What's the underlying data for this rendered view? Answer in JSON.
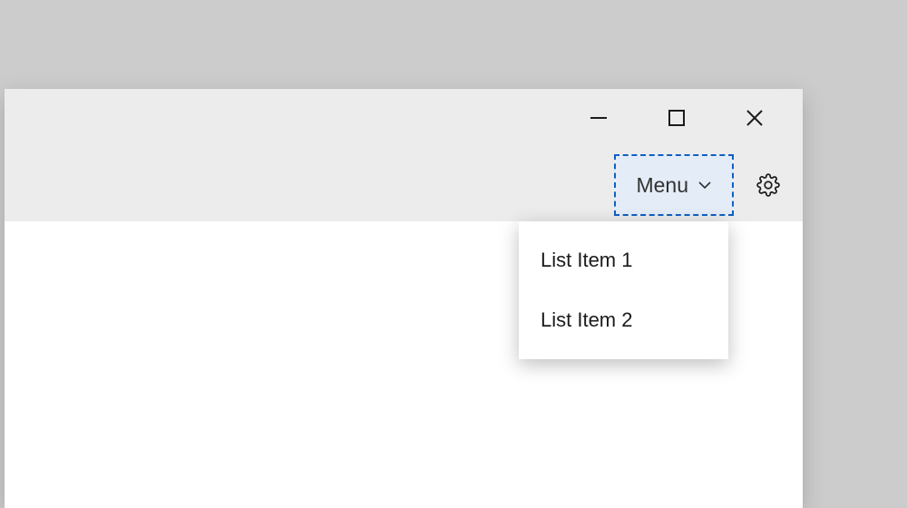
{
  "toolbar": {
    "menu_label": "Menu"
  },
  "dropdown": {
    "items": [
      {
        "label": "List Item 1"
      },
      {
        "label": "List Item 2"
      }
    ]
  }
}
